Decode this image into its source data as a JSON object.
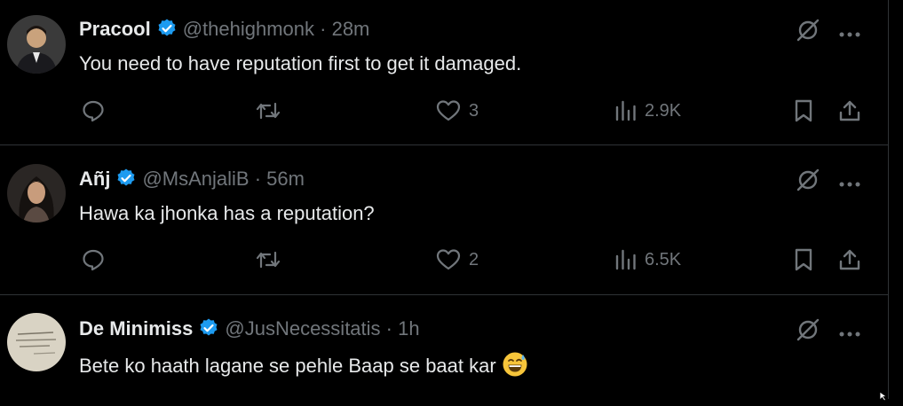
{
  "posts": [
    {
      "name": "Pracool",
      "handle": "@thehighmonk",
      "time": "· 28m",
      "text": "You need to have reputation first to get it damaged.",
      "likes": "3",
      "views": "2.9K"
    },
    {
      "name": "Añj",
      "handle": "@MsAnjaliB",
      "time": "· 56m",
      "text": "Hawa ka jhonka has a reputation?",
      "likes": "2",
      "views": "6.5K"
    },
    {
      "name": "De Minimiss",
      "handle": "@JusNecessitatis",
      "time": "· 1h",
      "text": "Bete ko haath lagane se pehle Baap se baat kar",
      "emoji_icon": "grinning-sweat-emoji"
    }
  ],
  "icons": [
    "verified-badge-icon",
    "grok-icon",
    "more-icon",
    "reply-icon",
    "repost-icon",
    "like-icon",
    "views-icon",
    "bookmark-icon",
    "share-icon"
  ],
  "colors": {
    "background": "#000000",
    "verified": "#1d9bf0",
    "muted": "#71767b",
    "text": "#e7e9ea",
    "divider": "#2f3336"
  }
}
